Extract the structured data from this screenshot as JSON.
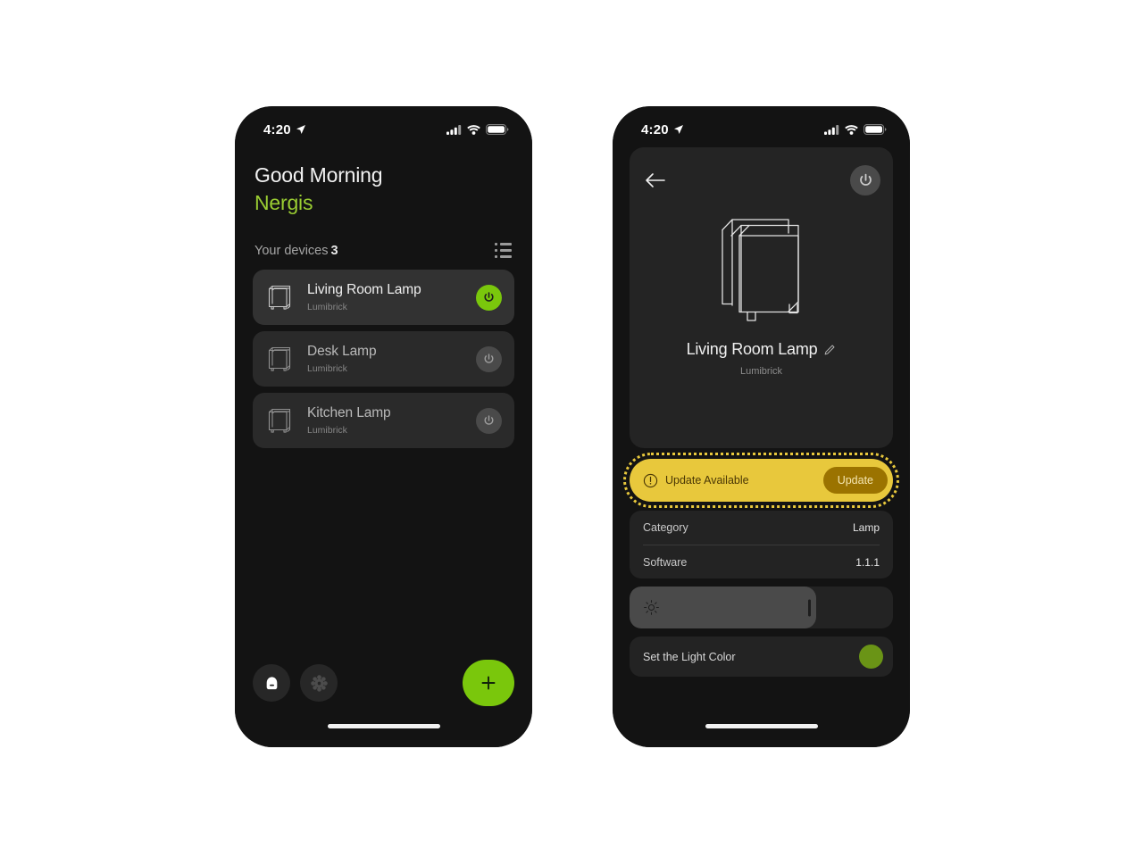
{
  "theme": {
    "page_bg": "#ffffff",
    "screen_bg": "#131313",
    "accent_green": "#7ac70c",
    "greeting_green": "#9acd32",
    "banner_yellow": "#e8c83c",
    "banner_button": "#9b7300",
    "light_color_swatch": "#6a9416",
    "card_bg": "#2a2a2a"
  },
  "status_bar": {
    "time": "4:20",
    "location_icon": "location-arrow-icon",
    "cellular_icon": "cellular-signal-icon",
    "wifi_icon": "wifi-icon",
    "battery_icon": "battery-icon"
  },
  "home_screen": {
    "greeting_line1": "Good Morning",
    "greeting_line2": "Nergis",
    "devices_label": "Your devices",
    "devices_count": "3",
    "view_toggle_icon": "list-view-icon",
    "devices": [
      {
        "name": "Living Room Lamp",
        "brand": "Lumibrick",
        "power": "on",
        "icon": "lamp-icon",
        "power_icon": "power-icon"
      },
      {
        "name": "Desk Lamp",
        "brand": "Lumibrick",
        "power": "off",
        "icon": "lamp-icon",
        "power_icon": "power-icon"
      },
      {
        "name": "Kitchen Lamp",
        "brand": "Lumibrick",
        "power": "off",
        "icon": "lamp-icon",
        "power_icon": "power-icon"
      }
    ],
    "toolbar": {
      "home_icon": "home-icon",
      "settings_icon": "gear-icon",
      "add_icon": "plus-icon"
    }
  },
  "detail_screen": {
    "back_icon": "back-arrow-icon",
    "power_icon": "power-icon",
    "device_illustration": "lamp-illustration",
    "device_name": "Living Room Lamp",
    "edit_icon": "pencil-icon",
    "device_brand": "Lumibrick",
    "banner": {
      "warning_icon": "exclamation-circle-icon",
      "message": "Update Available",
      "button_label": "Update"
    },
    "info_rows": [
      {
        "key": "Category",
        "value": "Lamp"
      },
      {
        "key": "Software",
        "value": "1.1.1"
      }
    ],
    "brightness": {
      "icon": "brightness-sun-icon",
      "value_percent": "71"
    },
    "light_color": {
      "label": "Set the Light Color",
      "swatch_color": "#6a9416"
    }
  }
}
